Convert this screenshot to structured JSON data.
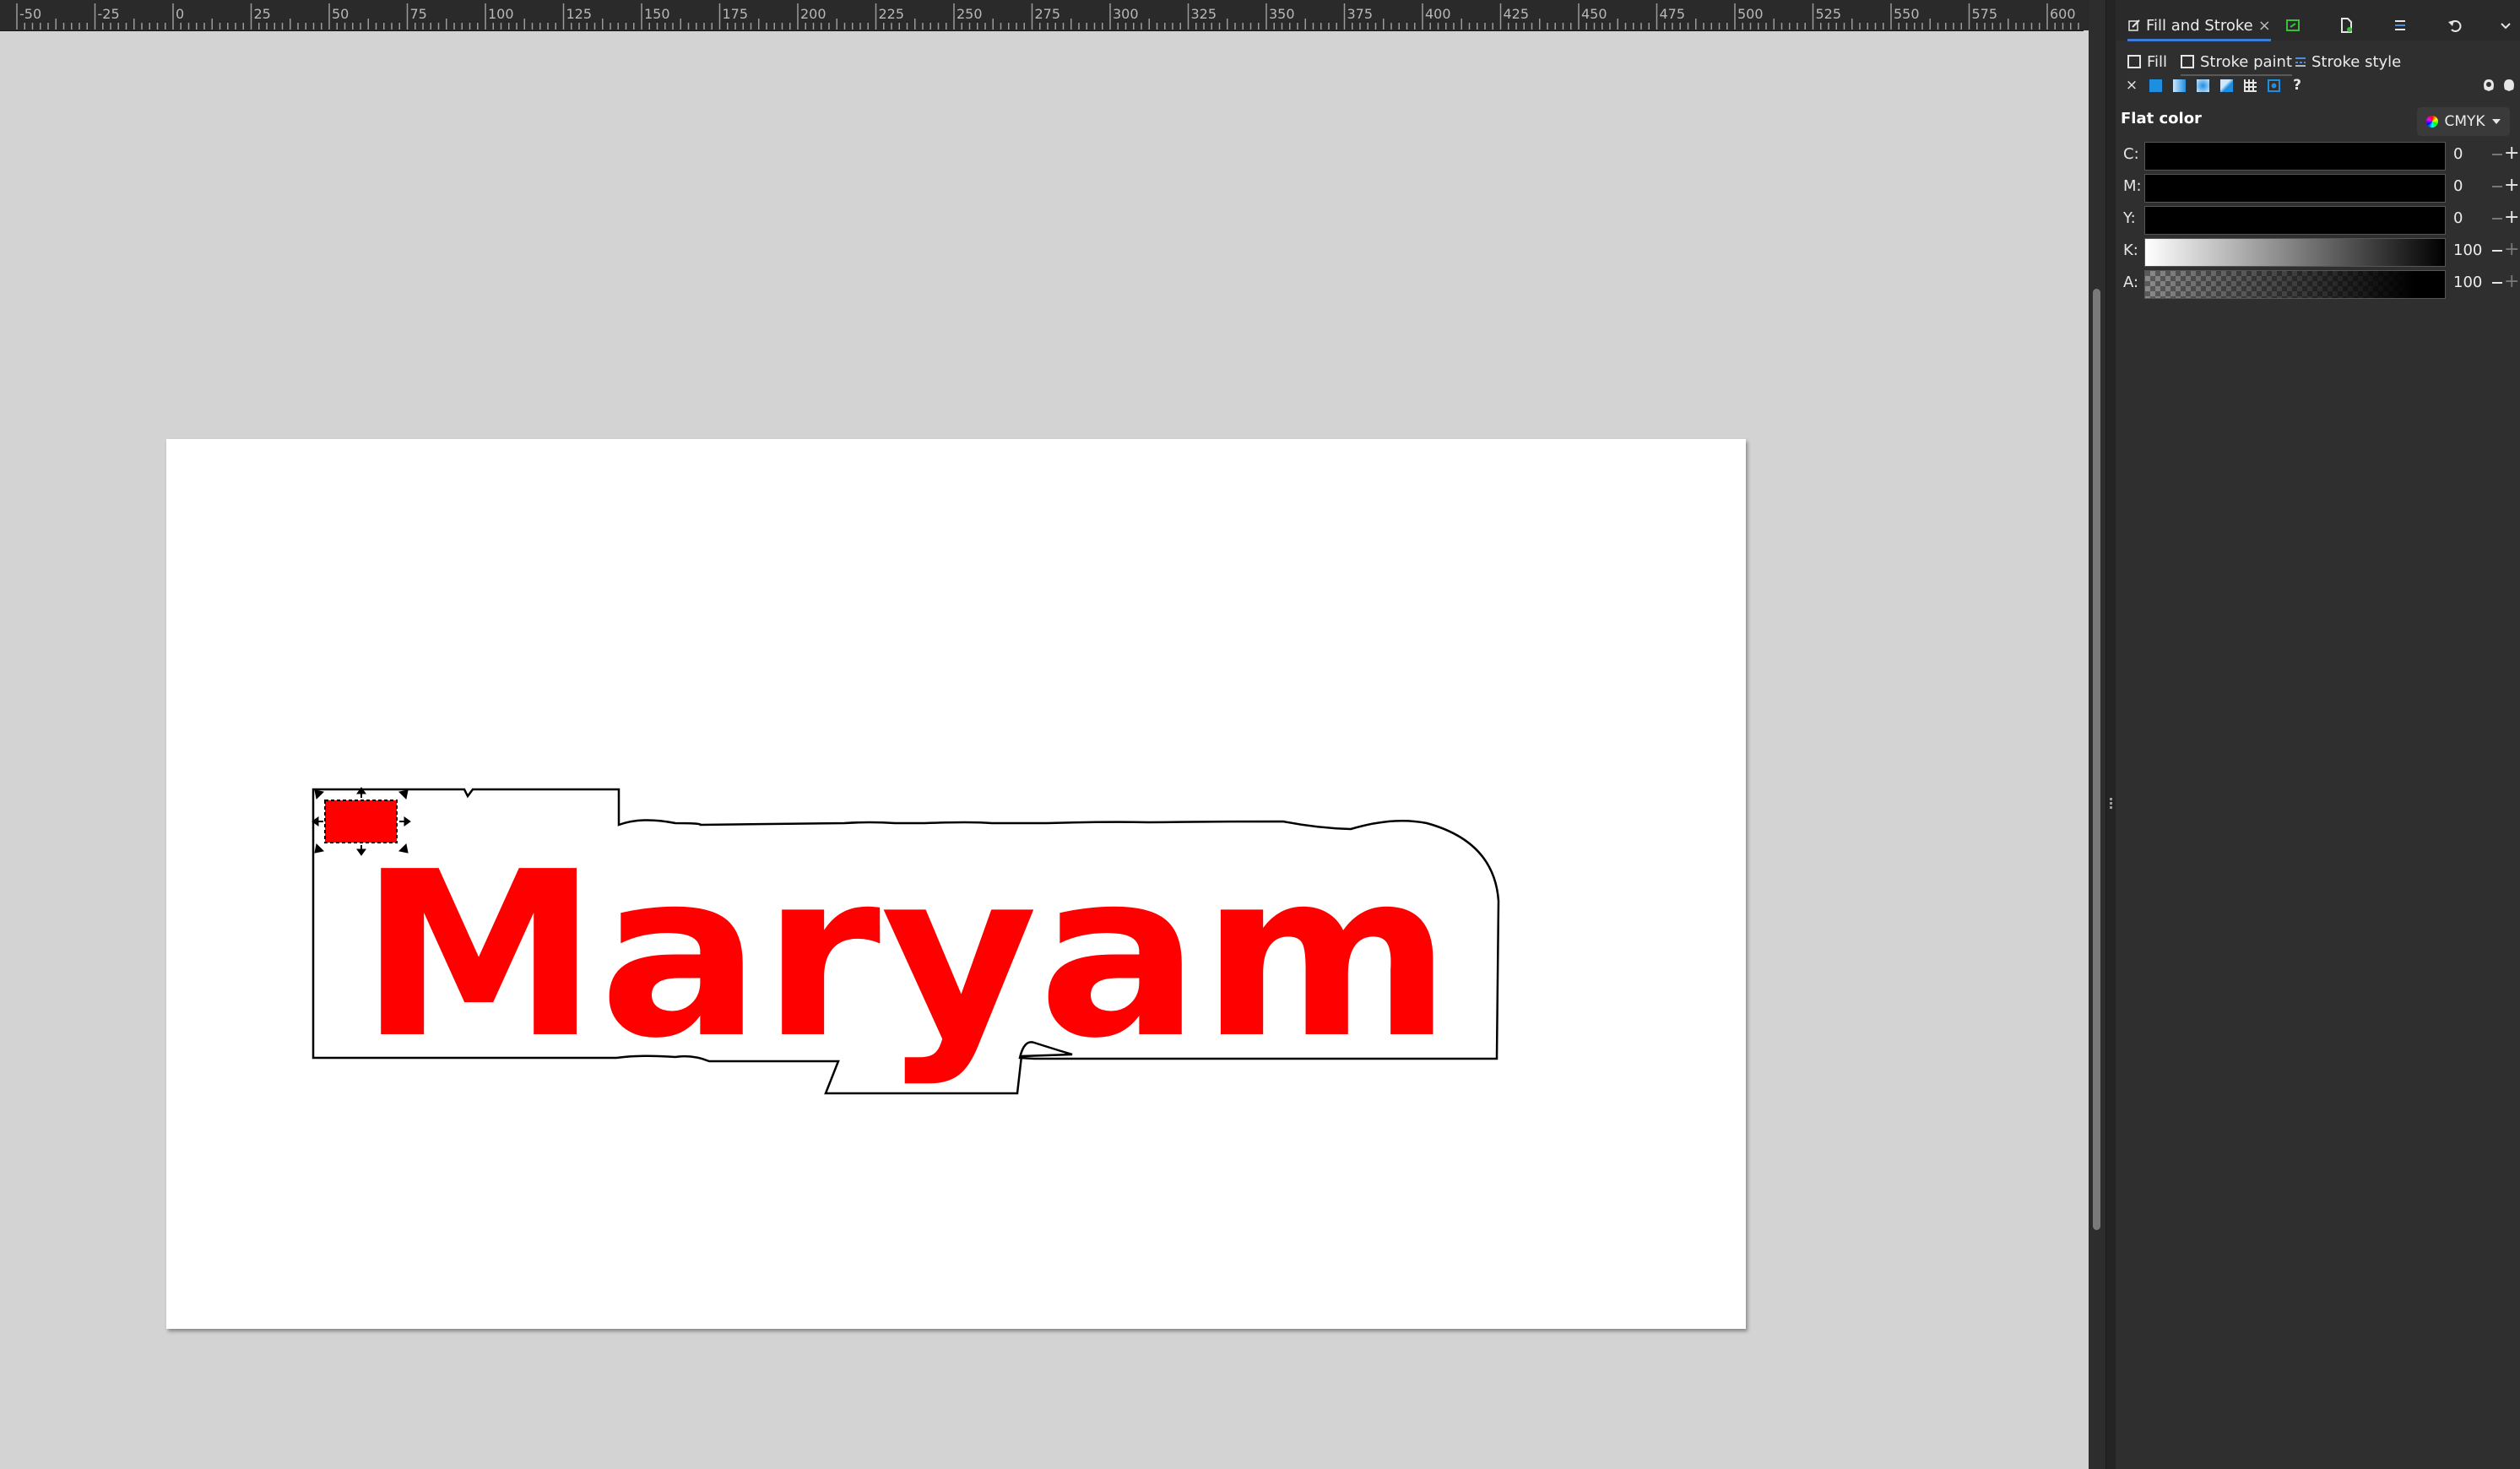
{
  "ruler": {
    "labels": [
      "-50",
      "-25",
      "0",
      "25",
      "50",
      "75",
      "100",
      "125",
      "150",
      "175",
      "200",
      "225",
      "250",
      "275",
      "300",
      "325",
      "350",
      "375",
      "400",
      "425",
      "450",
      "475",
      "500",
      "525",
      "550",
      "575",
      "600"
    ]
  },
  "canvas": {
    "text": "Maryam",
    "text_color": "#ff0000",
    "rect_color": "#ff0000"
  },
  "panel": {
    "dialog_title": "Fill and Stroke",
    "close_glyph": "×",
    "subtabs": {
      "fill": "Fill",
      "stroke_paint": "Stroke paint",
      "stroke_style": "Stroke style"
    },
    "paint_none_glyph": "×",
    "paint_unset_glyph": "?",
    "flat_color_label": "Flat color",
    "color_mode": "CMYK",
    "channels": [
      {
        "label": "C:",
        "value": "0"
      },
      {
        "label": "M:",
        "value": "0"
      },
      {
        "label": "Y:",
        "value": "0"
      },
      {
        "label": "K:",
        "value": "100"
      },
      {
        "label": "A:",
        "value": "100"
      }
    ]
  }
}
